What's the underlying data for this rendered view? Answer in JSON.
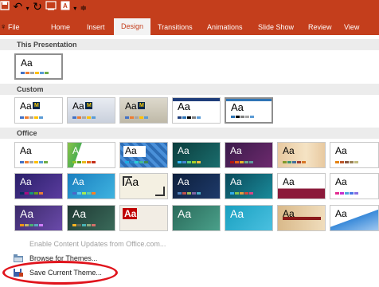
{
  "quick_access": {
    "save_icon": "save-icon",
    "undo_icon": "undo-icon",
    "redo_icon": "redo-icon",
    "start_icon": "start-from-beginning-icon",
    "present_icon": "present-icon",
    "customize_icon": "customize-icon"
  },
  "tabs": [
    {
      "label": "File"
    },
    {
      "label": "Home"
    },
    {
      "label": "Insert"
    },
    {
      "label": "Design"
    },
    {
      "label": "Transitions"
    },
    {
      "label": "Animations"
    },
    {
      "label": "Slide Show"
    },
    {
      "label": "Review"
    },
    {
      "label": "View"
    }
  ],
  "sections": {
    "this_presentation": "This Presentation",
    "custom": "Custom",
    "office": "Office"
  },
  "thumb_text": "Aa",
  "menu": {
    "enable_updates": "Enable Content Updates from Office.com...",
    "browse": "Browse for Themes...",
    "save": "Save Current Theme..."
  },
  "colors": {
    "ribbon": "#c43e1c",
    "highlight_circle": "#e0141c"
  }
}
